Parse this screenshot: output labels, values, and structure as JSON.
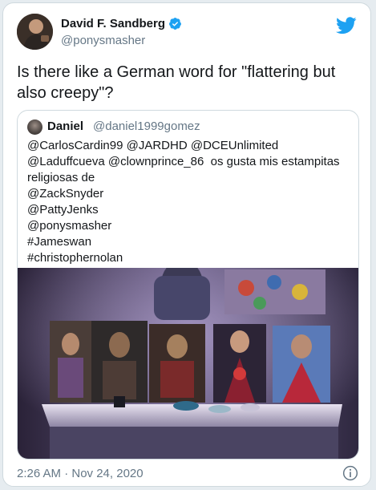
{
  "tweet": {
    "author_name": "David F. Sandberg",
    "author_handle": "@ponysmasher",
    "text": "Is there like a German word for \"flattering but also creepy\"?",
    "timestamp": "2:26 AM · Nov 24, 2020"
  },
  "quoted_tweet": {
    "author_name": "Daniel",
    "author_handle": "@daniel1999gomez",
    "text": "@CarlosCardin99 @JARDHD @DCEUnlimited\n@Laduffcueva @clownprince_86  os gusta mis estampitas religiosas de\n@ZackSnyder\n@PattyJenks\n@ponysmasher\n#Jameswan\n#christophernolan"
  },
  "colors": {
    "brand": "#1da1f2",
    "text": "#14171a",
    "secondary_text": "#657786"
  },
  "icons": {
    "verified": "verified-badge-icon",
    "logo": "twitter-bird-icon",
    "info": "info-icon"
  }
}
